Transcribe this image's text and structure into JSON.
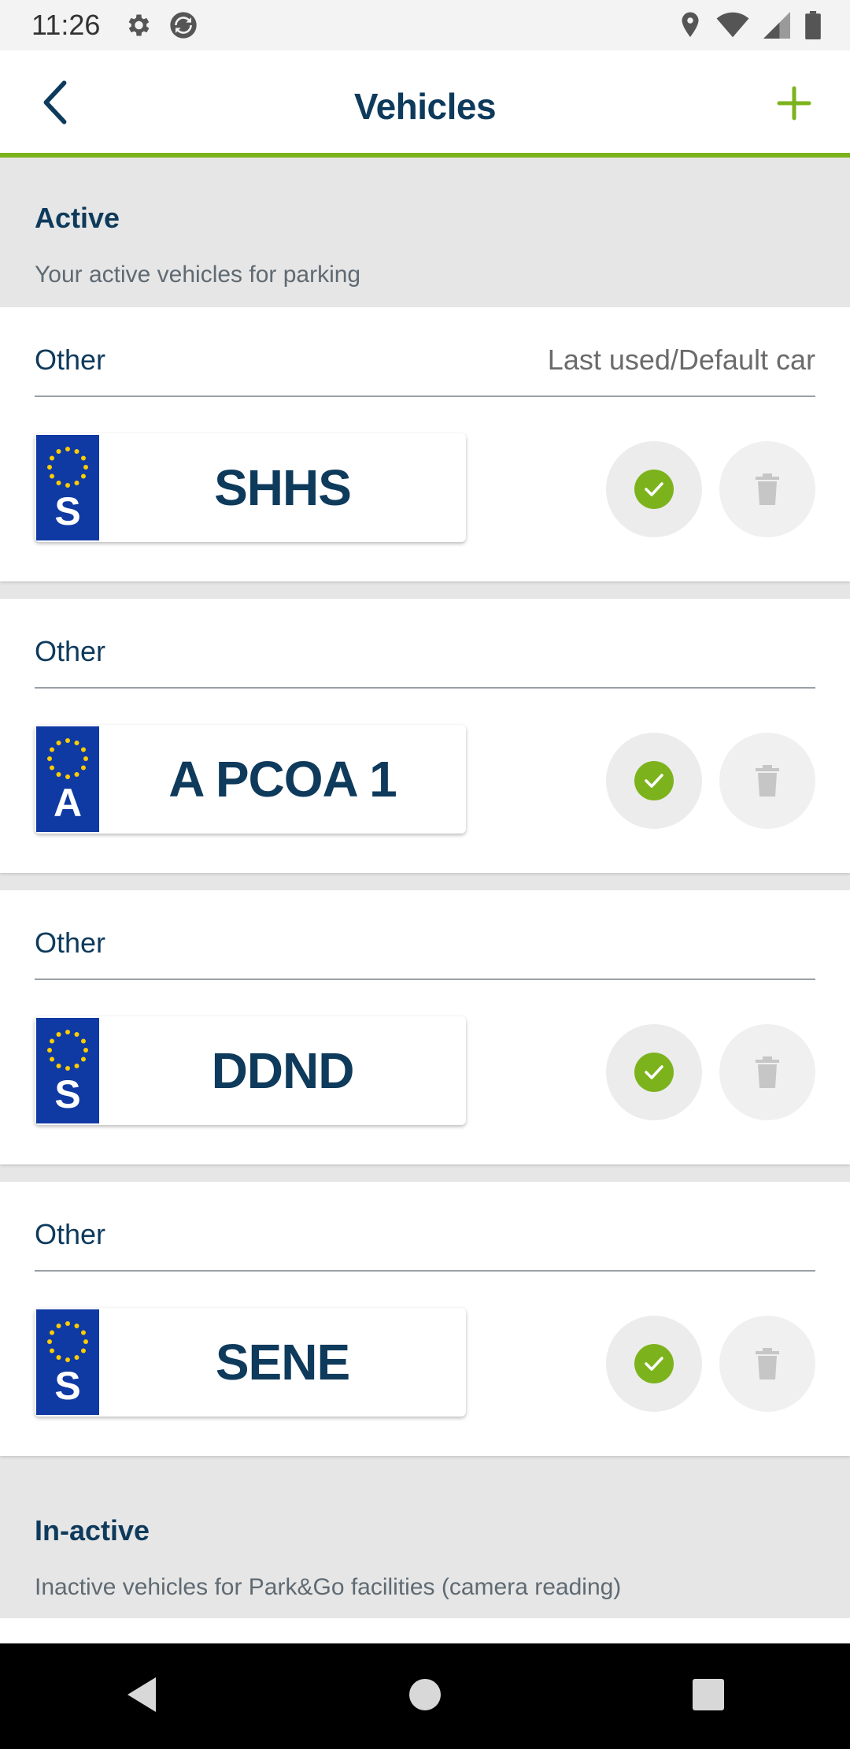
{
  "status_bar": {
    "time": "11:26",
    "icons": [
      "settings-icon",
      "sync-icon",
      "location-icon",
      "wifi-icon",
      "signal-icon",
      "battery-icon"
    ]
  },
  "app_bar": {
    "title": "Vehicles",
    "back_icon": "back-arrow-icon",
    "add_icon": "plus-icon",
    "accent_color": "#7cb31d"
  },
  "sections": {
    "active": {
      "title": "Active",
      "subtitle": "Your active vehicles for parking"
    },
    "inactive": {
      "title": "In-active",
      "subtitle": "Inactive vehicles for Park&Go facilities (camera reading)"
    }
  },
  "vehicles": [
    {
      "type": "Other",
      "note": "Last used/Default car",
      "country": "S",
      "plate": "SHHS"
    },
    {
      "type": "Other",
      "note": "",
      "country": "A",
      "plate": "A PCOA 1"
    },
    {
      "type": "Other",
      "note": "",
      "country": "S",
      "plate": "DDND"
    },
    {
      "type": "Other",
      "note": "",
      "country": "S",
      "plate": "SENE"
    }
  ],
  "colors": {
    "primary_text": "#0e3a5c",
    "accent": "#7cb31d",
    "plate_band": "#0f3aa4"
  },
  "nav_bar": {
    "icons": [
      "nav-back-icon",
      "nav-home-icon",
      "nav-recents-icon"
    ]
  }
}
